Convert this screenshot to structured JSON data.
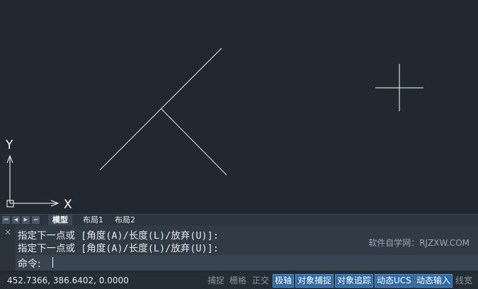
{
  "tabs": {
    "nav_buttons": [
      "first",
      "prev",
      "next",
      "last"
    ],
    "items": [
      {
        "label": "模型",
        "active": true
      },
      {
        "label": "布局1",
        "active": false
      },
      {
        "label": "布局2",
        "active": false
      }
    ]
  },
  "ucs": {
    "x_label": "X",
    "y_label": "Y"
  },
  "command": {
    "close_glyph": "✕",
    "history": [
      "指定下一点或 [角度(A)/长度(L)/放弃(U)]:",
      "指定下一点或 [角度(A)/长度(L)/放弃(U)]:"
    ],
    "prompt": "命令:",
    "watermark": "软件自学网：RJZXW.COM"
  },
  "status": {
    "coordinates": "452.7366, 386.6402, 0.0000",
    "toggles": [
      {
        "label": "捕捉",
        "on": false
      },
      {
        "label": "栅格",
        "on": false
      },
      {
        "label": "正交",
        "on": false
      },
      {
        "label": "极轴",
        "on": true
      },
      {
        "label": "对象捕捉",
        "on": true
      },
      {
        "label": "对象追踪",
        "on": true
      },
      {
        "label": "动态UCS",
        "on": true
      },
      {
        "label": "动态输入",
        "on": true
      },
      {
        "label": "线宽",
        "on": false
      }
    ]
  },
  "colors": {
    "canvas": "#212830",
    "line": "#ffffff",
    "status_on": "#2f6aa3"
  }
}
